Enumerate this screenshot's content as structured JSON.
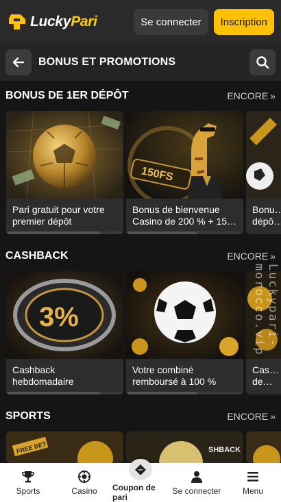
{
  "header": {
    "logo_word1": "Lucky",
    "logo_word2": "Pari",
    "login_label": "Se connecter",
    "signup_label": "Inscription"
  },
  "titlebar": {
    "title": "BONUS ET PROMOTIONS"
  },
  "sections": [
    {
      "title": "BONUS DE 1ER DÉPÔT",
      "more": "ENCORE",
      "cards": [
        {
          "caption": "Pari gratuit pour votre premier dépôt"
        },
        {
          "caption": "Bonus de bienvenue Casino de 200 % + 15…"
        },
        {
          "caption": "Bonu… dépô…"
        }
      ]
    },
    {
      "title": "CASHBACK",
      "more": "ENCORE",
      "cards": [
        {
          "caption": "Cashback hebdomadaire"
        },
        {
          "caption": "Votre combiné remboursé à 100 %"
        },
        {
          "caption": "Cas… de…"
        }
      ]
    },
    {
      "title": "SPORTS",
      "more": "ENCORE"
    }
  ],
  "art_text": {
    "fs_badge": "150FS",
    "cashback_percent": "3%",
    "free_bet": "FREE BET",
    "shback": "SHBACK"
  },
  "watermark": "Luckypari-morocco.vip",
  "bottom_nav": [
    {
      "label": "Sports",
      "icon": "trophy-icon"
    },
    {
      "label": "Casino",
      "icon": "casino-chip-icon"
    },
    {
      "label": "Coupon de pari",
      "icon": "ticket-icon",
      "active": true
    },
    {
      "label": "Se connecter",
      "icon": "user-icon"
    },
    {
      "label": "Menu",
      "icon": "hamburger-icon"
    }
  ],
  "colors": {
    "accent": "#ffc107",
    "background": "#151515",
    "header": "#2a2a2a"
  }
}
